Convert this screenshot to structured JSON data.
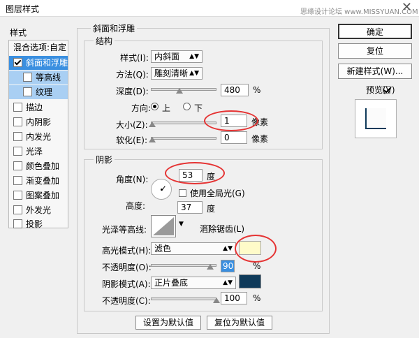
{
  "window": {
    "title": "图层样式",
    "close_glyph": "✕",
    "watermark": "思缘设计论坛 www.MISSYUAN.COM"
  },
  "sidebar": {
    "header": "样式",
    "blend_options": "混合选项:自定",
    "items": [
      {
        "label": "斜面和浮雕",
        "checked": true
      },
      {
        "label": "等高线",
        "checked": false
      },
      {
        "label": "纹理",
        "checked": false
      },
      {
        "label": "描边",
        "checked": false
      },
      {
        "label": "内阴影",
        "checked": false
      },
      {
        "label": "内发光",
        "checked": false
      },
      {
        "label": "光泽",
        "checked": false
      },
      {
        "label": "颜色叠加",
        "checked": false
      },
      {
        "label": "渐变叠加",
        "checked": false
      },
      {
        "label": "图案叠加",
        "checked": false
      },
      {
        "label": "外发光",
        "checked": false
      },
      {
        "label": "投影",
        "checked": false
      }
    ]
  },
  "bevel": {
    "group_title": "斜面和浮雕",
    "structure_title": "结构",
    "style_label": "样式(I):",
    "style_value": "内斜面",
    "technique_label": "方法(Q):",
    "technique_value": "雕刻清晰",
    "depth_label": "深度(D):",
    "depth_value": "480",
    "depth_unit": "%",
    "depth_level": 0.42,
    "direction_label": "方向:",
    "dir_up": "上",
    "dir_down": "下",
    "direction_selected": "上",
    "size_label": "大小(Z):",
    "size_value": "1",
    "size_unit": "像素",
    "size_level": 0.0,
    "soften_label": "软化(E):",
    "soften_value": "0",
    "soften_unit": "像素",
    "soften_level": 0.0
  },
  "shading": {
    "title": "阴影",
    "angle_label": "角度(N):",
    "angle_value": "53",
    "angle_unit": "度",
    "global_light_label": "使用全局光(G)",
    "global_light_checked": false,
    "altitude_label": "高度:",
    "altitude_value": "37",
    "altitude_unit": "度",
    "gloss_label": "光泽等高线:",
    "antialias_label": "消除锯齿(L)",
    "antialias_checked": false,
    "highlight_mode_label": "高光模式(H):",
    "highlight_mode_value": "滤色",
    "highlight_color": "#fffbc9",
    "highlight_opacity_label": "不透明度(O):",
    "highlight_opacity_value": "90",
    "highlight_opacity_unit": "%",
    "highlight_opacity_level": 0.9,
    "shadow_mode_label": "阴影模式(A):",
    "shadow_mode_value": "正片叠底",
    "shadow_color": "#0f3a5a",
    "shadow_opacity_label": "不透明度(C):",
    "shadow_opacity_value": "100",
    "shadow_opacity_unit": "%",
    "shadow_opacity_level": 1.0
  },
  "footer": {
    "make_default": "设置为默认值",
    "reset_default": "复位为默认值"
  },
  "right": {
    "ok": "确定",
    "reset": "复位",
    "new_style": "新建样式(W)...",
    "preview_label": "预览(V)",
    "preview_checked": true
  },
  "colors": {
    "accent": "#3a8fe0",
    "annotation": "#e53333"
  }
}
